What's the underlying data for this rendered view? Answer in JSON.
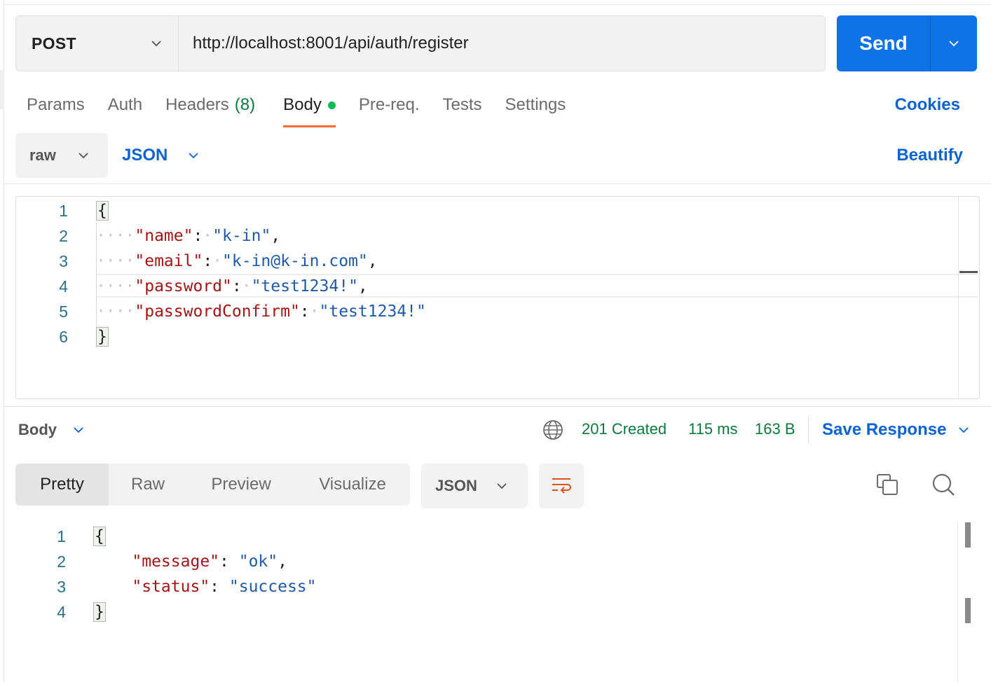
{
  "request": {
    "method": "POST",
    "url": "http://localhost:8001/api/auth/register",
    "send_label": "Send"
  },
  "tabs": [
    {
      "label": "Params"
    },
    {
      "label": "Auth"
    },
    {
      "label": "Headers",
      "count": "(8)"
    },
    {
      "label": "Body",
      "active": true
    },
    {
      "label": "Pre-req."
    },
    {
      "label": "Tests"
    },
    {
      "label": "Settings"
    }
  ],
  "cookies_label": "Cookies",
  "body_mode": {
    "type": "raw",
    "language": "JSON",
    "beautify_label": "Beautify"
  },
  "request_body": {
    "line_numbers": [
      "1",
      "2",
      "3",
      "4",
      "5",
      "6"
    ],
    "lines": [
      {
        "text": "{"
      },
      {
        "key": "\"name\"",
        "value": "\"k-in\"",
        "trail": ","
      },
      {
        "key": "\"email\"",
        "value": "\"k-in@k-in.com\"",
        "trail": ","
      },
      {
        "key": "\"password\"",
        "value": "\"test1234!\"",
        "trail": ","
      },
      {
        "key": "\"passwordConfirm\"",
        "value": "\"test1234!\"",
        "trail": ""
      },
      {
        "text": "}"
      }
    ]
  },
  "response": {
    "view_label": "Body",
    "status": "201 Created",
    "time": "115 ms",
    "size": "163 B",
    "save_label": "Save Response",
    "views": [
      "Pretty",
      "Raw",
      "Preview",
      "Visualize"
    ],
    "active_view": "Pretty",
    "format": "JSON",
    "line_numbers": [
      "1",
      "2",
      "3",
      "4"
    ],
    "lines": [
      {
        "text": "{"
      },
      {
        "key": "\"message\"",
        "value": "\"ok\"",
        "trail": ","
      },
      {
        "key": "\"status\"",
        "value": "\"success\"",
        "trail": ""
      },
      {
        "text": "}"
      }
    ]
  },
  "colors": {
    "accent": "#0f73e8",
    "link": "#0a63d1",
    "status_ok": "#0b7a3e",
    "tab_underline": "#ff6c37",
    "json_key": "#a31515",
    "json_string": "#1f5aa8"
  }
}
